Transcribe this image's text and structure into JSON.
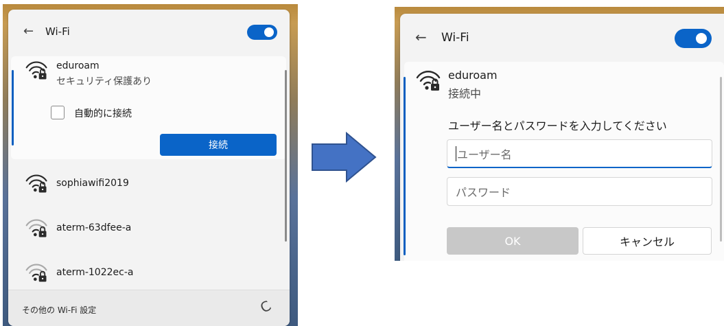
{
  "left": {
    "title": "Wi-Fi",
    "back_icon": "←",
    "wifi_on": true,
    "selected": {
      "name": "eduroam",
      "status": "セキュリティ保護あり",
      "auto_connect_label": "自動的に接続",
      "connect_label": "接続"
    },
    "networks": [
      {
        "name": "sophiawifi2019"
      },
      {
        "name": "aterm-63dfee-a"
      },
      {
        "name": "aterm-1022ec-a"
      }
    ],
    "footer_link": "その他の Wi-Fi 設定",
    "refresh_icon": "C"
  },
  "right": {
    "title": "Wi-Fi",
    "back_icon": "←",
    "wifi_on": true,
    "selected": {
      "name": "eduroam",
      "status": "接続中",
      "prompt": "ユーザー名とパスワードを入力してください",
      "username_placeholder": "ユーザー名",
      "password_placeholder": "パスワード",
      "ok_label": "OK",
      "cancel_label": "キャンセル"
    }
  },
  "colors": {
    "accent": "#0a64c8",
    "arrow": "#4472c4"
  }
}
